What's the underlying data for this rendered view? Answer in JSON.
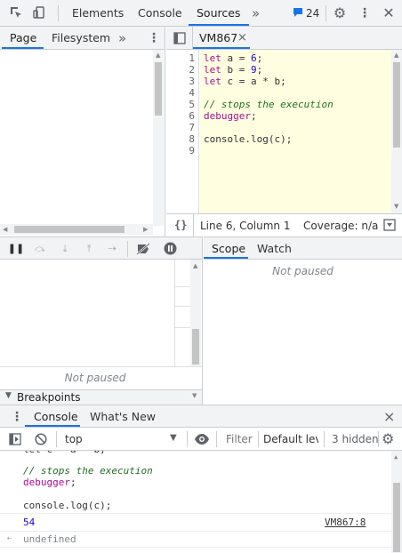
{
  "toolbar": {
    "tabs": [
      {
        "label": "Elements"
      },
      {
        "label": "Console"
      },
      {
        "label": "Sources"
      }
    ],
    "more_label": "»",
    "issues_count": "24"
  },
  "navigator": {
    "tabs": [
      {
        "label": "Page"
      },
      {
        "label": "Filesystem"
      }
    ],
    "more_label": "»"
  },
  "editor": {
    "file_tab": "VM867",
    "close_label": "×",
    "lines": [
      {
        "n": "1"
      },
      {
        "n": "2"
      },
      {
        "n": "3"
      },
      {
        "n": "4"
      },
      {
        "n": "5"
      },
      {
        "n": "6"
      },
      {
        "n": "7"
      },
      {
        "n": "8"
      },
      {
        "n": "9"
      }
    ],
    "code": {
      "l1_kw": "let",
      "l1_rest": " a = ",
      "l1_num": "6",
      "l1_end": ";",
      "l2_kw": "let",
      "l2_rest": " b = ",
      "l2_num": "9",
      "l2_end": ";",
      "l3_kw": "let",
      "l3_rest": " c = a * b;",
      "l5_cmt": "// stops the execution",
      "l6_kw": "debugger",
      "l6_end": ";",
      "l8": "console.log(c);"
    }
  },
  "statusbar": {
    "braces": "{}",
    "position": "Line 6, Column 1",
    "coverage": "Coverage: n/a"
  },
  "debugger": {
    "tabs": [
      {
        "label": "Scope"
      },
      {
        "label": "Watch"
      }
    ],
    "scope_status": "Not paused",
    "callstack_status": "Not paused",
    "breakpoints_label": "Breakpoints"
  },
  "drawer": {
    "tabs": [
      {
        "label": "Console"
      },
      {
        "label": "What's New"
      }
    ],
    "close_label": "×",
    "context": "top",
    "filter_placeholder": "Filter",
    "levels": "Default lev",
    "hidden": "3 hidden"
  },
  "console": {
    "cmt": "// stops the execution",
    "debugger_kw": "debugger",
    "debugger_end": ";",
    "log_line": "console.log(c);",
    "output_value": "54",
    "output_source": "VM867:8",
    "result_arrow": "⇠",
    "result": "undefined"
  },
  "colors": {
    "accent": "#1a73e8",
    "keyword": "#aa0d91",
    "number": "#1c00cf",
    "comment": "#236e25",
    "editor_bg": "#fffee0"
  }
}
